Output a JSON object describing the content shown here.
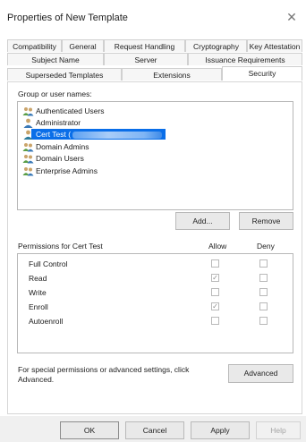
{
  "window": {
    "title": "Properties of New Template",
    "close_glyph": "✕"
  },
  "tabs_row1": [
    "Compatibility",
    "General",
    "Request Handling",
    "Cryptography",
    "Key Attestation"
  ],
  "tabs_row2": [
    "Subject Name",
    "Server",
    "Issuance Requirements"
  ],
  "tabs_row3": [
    "Superseded Templates",
    "Extensions",
    "Security"
  ],
  "active_tab": "Security",
  "group_label": "Group or user names:",
  "users": [
    {
      "name": "Authenticated Users",
      "icon": "group-icon",
      "selected": false
    },
    {
      "name": "Administrator",
      "icon": "user-icon",
      "selected": false
    },
    {
      "name": "Cert Test (",
      "icon": "user-icon",
      "selected": true
    },
    {
      "name": "Domain Admins",
      "icon": "group-icon",
      "selected": false
    },
    {
      "name": "Domain Users",
      "icon": "group-icon",
      "selected": false
    },
    {
      "name": "Enterprise Admins",
      "icon": "group-icon",
      "selected": false
    }
  ],
  "buttons": {
    "add": "Add...",
    "remove": "Remove",
    "advanced": "Advanced",
    "ok": "OK",
    "cancel": "Cancel",
    "apply": "Apply",
    "help": "Help"
  },
  "permissions_label": "Permissions for Cert Test",
  "allow_label": "Allow",
  "deny_label": "Deny",
  "permissions": [
    {
      "name": "Full Control",
      "allow": false,
      "deny": false
    },
    {
      "name": "Read",
      "allow": true,
      "deny": false
    },
    {
      "name": "Write",
      "allow": false,
      "deny": false
    },
    {
      "name": "Enroll",
      "allow": true,
      "deny": false
    },
    {
      "name": "Autoenroll",
      "allow": false,
      "deny": false
    }
  ],
  "special_text_line1": "For special permissions or advanced settings, click",
  "special_text_line2": "Advanced.",
  "colors": {
    "selection": "#0a6ee8",
    "user_head": "#caa46a",
    "user_body": "#3a79b7",
    "group_body": "#5a9e46"
  }
}
